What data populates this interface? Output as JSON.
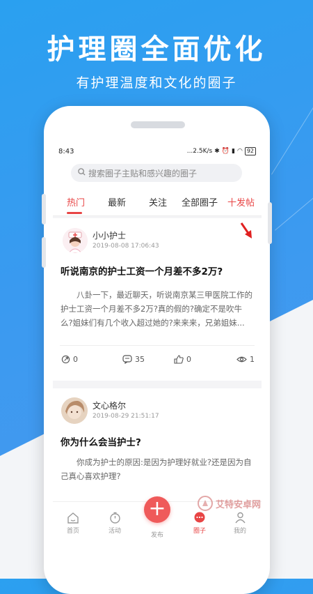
{
  "promo": {
    "headline": "护理圈全面优化",
    "subline": "有护理温度和文化的圈子"
  },
  "status_bar": {
    "time": "8:43",
    "speed": "...2.5K/s",
    "battery": "92"
  },
  "search": {
    "placeholder": "搜索圈子主贴和感兴趣的圈子"
  },
  "tabs": [
    {
      "label": "热门",
      "active": true
    },
    {
      "label": "最新",
      "active": false
    },
    {
      "label": "关注",
      "active": false
    },
    {
      "label": "全部圈子",
      "active": false
    }
  ],
  "post_button_label": "十发帖",
  "posts": [
    {
      "author": "小小护士",
      "time": "2019-08-08 17:06:43",
      "title": "听说南京的护士工资一个月差不多2万?",
      "excerpt": "八卦一下，最近聊天，听说南京某三甲医院工作的护士工资一个月差不多2万?真的假的?确定不是吹牛么?姐妹们有几个收入超过她的?来来来，兄弟姐妹...",
      "shares": "0",
      "comments": "35",
      "likes": "0",
      "views": "1"
    },
    {
      "author": "文心格尔",
      "time": "2019-08-29 21:51:17",
      "title": "你为什么会当护士?",
      "excerpt": "你成为护士的原因:是因为护理好就业?还是因为自己真心喜欢护理?"
    }
  ],
  "bottom_nav": [
    {
      "label": "首页",
      "icon": "home-icon"
    },
    {
      "label": "活动",
      "icon": "timer-icon"
    },
    {
      "label": "发布",
      "icon": "plus-icon"
    },
    {
      "label": "圈子",
      "icon": "chat-bubble-icon",
      "active": true
    },
    {
      "label": "我的",
      "icon": "person-icon"
    }
  ],
  "watermark": "艾特安卓网",
  "colors": {
    "accent": "#e84545",
    "background_blue": "#2aa0f0"
  }
}
